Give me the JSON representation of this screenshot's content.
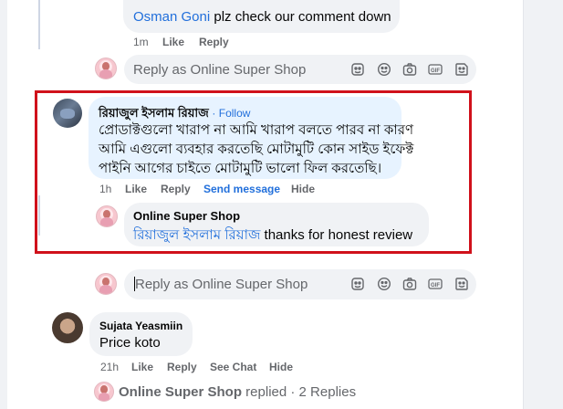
{
  "comments": {
    "osman": {
      "mention": "Osman Goni",
      "text": " plz check our comment down",
      "time": "1m",
      "like": "Like",
      "reply": "Reply"
    },
    "reply_box_top": {
      "placeholder": "Reply as Online Super Shop"
    },
    "riyaz": {
      "author": "রিয়াজুল ইসলাম রিয়াজ",
      "follow": "· Follow",
      "line1": "প্রোডাক্টগুলো খারাপ না আমি খারাপ বলতে পারব না কারণ",
      "line2": "আমি এগুলো ব্যবহার করতেছি মোটামুটি কোন সাইড ইফেক্ট",
      "line3": "পাইনি আগের চাইতে মোটামুটি ভালো ফিল করতেছি।",
      "time": "1h",
      "like": "Like",
      "reply": "Reply",
      "send_message": "Send message",
      "hide": "Hide"
    },
    "shop_reply": {
      "author": "Online Super Shop",
      "mention": "রিয়াজুল ইসলাম রিয়াজ",
      "text": " thanks for honest review"
    },
    "reply_box_bottom": {
      "placeholder": "Reply as Online Super Shop"
    },
    "sujata": {
      "author": "Sujata Yeasmiin",
      "text": "Price koto",
      "time": "21h",
      "like": "Like",
      "reply": "Reply",
      "see_chat": "See Chat",
      "hide": "Hide"
    },
    "replied": {
      "author": "Online Super Shop",
      "text": " replied · 2 Replies"
    }
  },
  "toolbar_icons": [
    "sticker-avatar-icon",
    "emoji-icon",
    "camera-icon",
    "gif-icon",
    "sticker-icon"
  ],
  "colors": {
    "link_blue": "#216fdb",
    "highlight_red": "#d0111b",
    "bubble_gray": "#f0f2f5",
    "bubble_blue": "#e7f3ff",
    "meta_gray": "#65676b"
  }
}
